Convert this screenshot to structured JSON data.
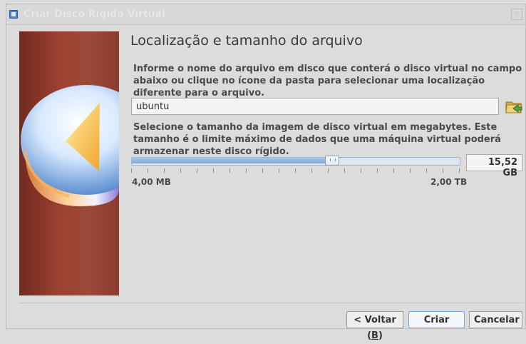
{
  "window": {
    "title": "Criar Disco Rígido Virtual"
  },
  "page": {
    "heading": "Localização e tamanho do arquivo",
    "file_instruction": "Informe o nome do arquivo em disco que conterá o disco virtual no campo abaixo ou clique no ícone da pasta para selecionar uma localização diferente para o arquivo.",
    "file_name_value": "ubuntu",
    "size_instruction": "Selecione o tamanho da imagem de disco virtual em megabytes. Este tamanho é o limite máximo de dados que uma máquina virtual poderá armazenar neste disco rígido.",
    "slider_value_fraction": 0.61,
    "size_value": "15,52 GB",
    "min_label": "4,00 MB",
    "max_label": "2,00 TB"
  },
  "buttons": {
    "back_prefix": "< Voltar (",
    "back_mnemonic": "B",
    "back_suffix": ")",
    "create": "Criar",
    "cancel": "Cancelar"
  },
  "icons": {
    "title_icon": "virtualbox-icon",
    "close_icon": "close-icon",
    "folder_icon": "folder-icon",
    "disk_art": "hard-disk-icon"
  },
  "colors": {
    "accent": "#7aa4d6",
    "left_panel": "#9d4130"
  }
}
